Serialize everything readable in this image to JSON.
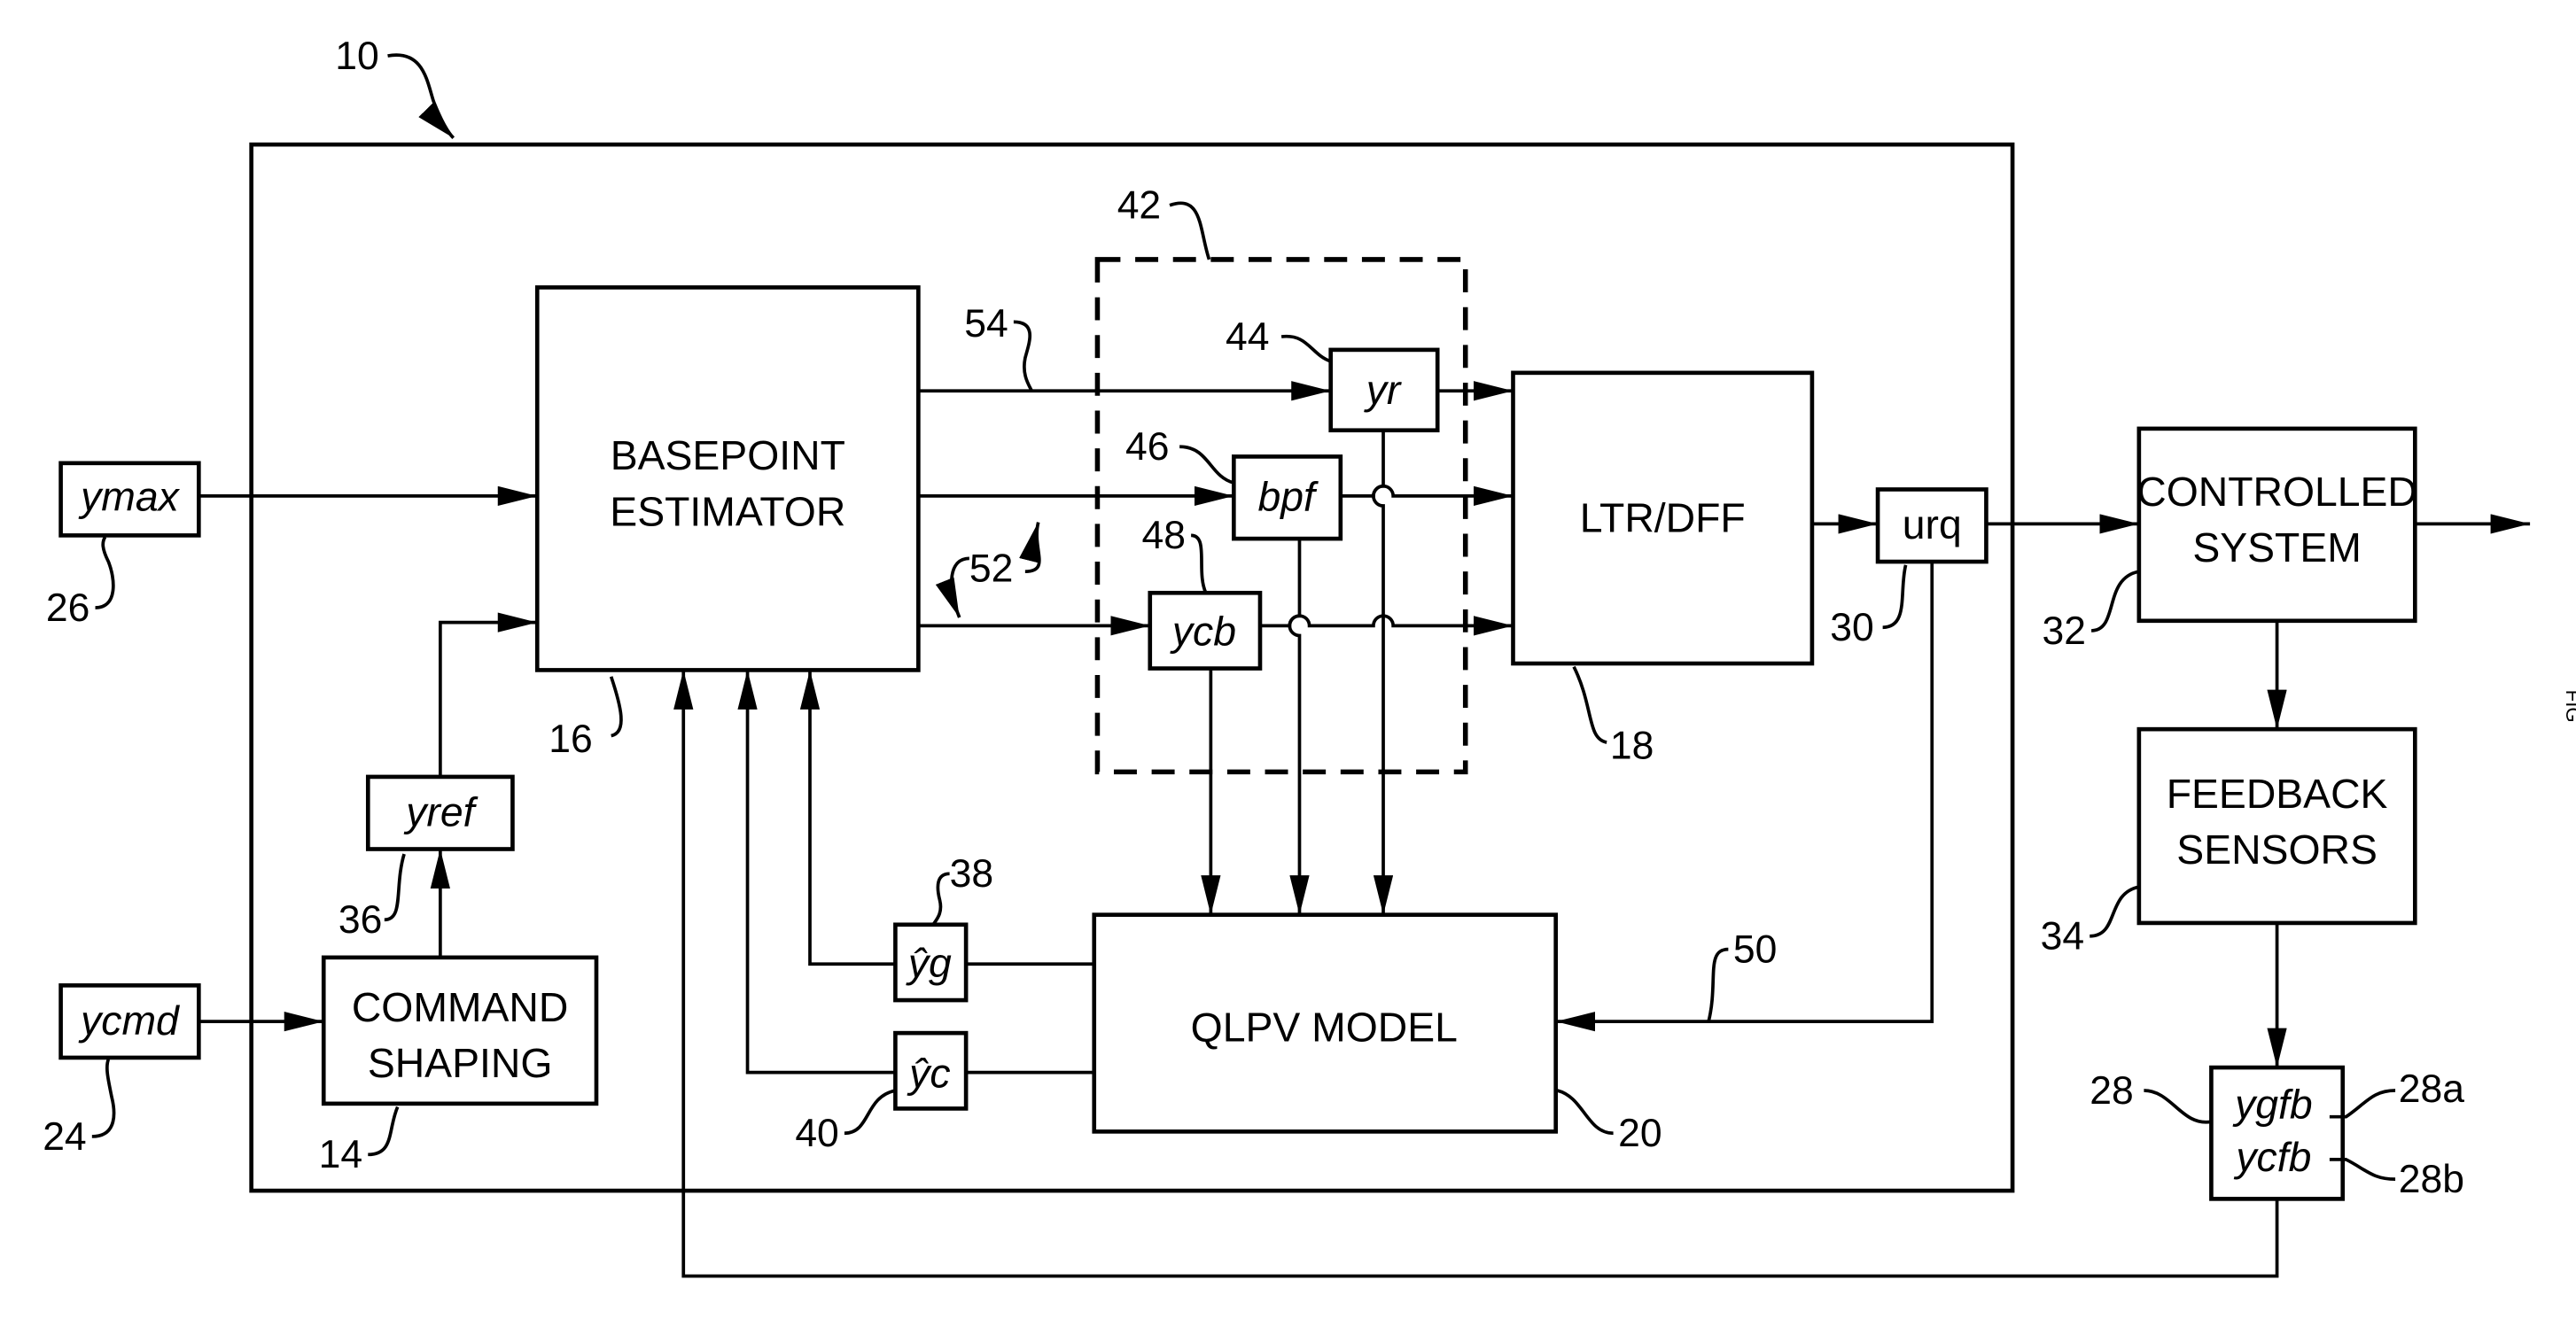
{
  "figure": {
    "system_ref": "10",
    "blocks": {
      "basepoint_estimator": {
        "line1": "BASEPOINT",
        "line2": "ESTIMATOR",
        "ref": "16"
      },
      "ltr_dff": {
        "label": "LTR/DFF",
        "ref": "18"
      },
      "qlpv_model": {
        "label": "QLPV MODEL",
        "ref": "20"
      },
      "command_shaping": {
        "line1": "COMMAND",
        "line2": "SHAPING",
        "ref": "14"
      },
      "controlled_system": {
        "line1": "CONTROLLED",
        "line2": "SYSTEM",
        "ref": "32"
      },
      "feedback_sensors": {
        "line1": "FEEDBACK",
        "line2": "SENSORS",
        "ref": "34"
      },
      "limiter_group": {
        "ref": "42"
      }
    },
    "signals": {
      "ymax": {
        "label": "ymax",
        "ref": "26"
      },
      "ycmd": {
        "label": "ycmd",
        "ref": "24"
      },
      "yref": {
        "label": "yref",
        "ref": "36"
      },
      "yr": {
        "label": "yr",
        "ref": "44"
      },
      "bpf": {
        "label": "bpf",
        "ref": "46"
      },
      "ycb": {
        "label": "ycb",
        "ref": "48"
      },
      "urq": {
        "label": "urq",
        "ref": "30"
      },
      "yg_hat": {
        "label": "ŷg",
        "ref": "38"
      },
      "yc_hat": {
        "label": "ŷc",
        "ref": "40"
      },
      "feedback": {
        "line1": "ygfb",
        "line2": "ycfb",
        "ref": "28",
        "ref_a": "28a",
        "ref_b": "28b"
      }
    },
    "path_refs": {
      "path_54": "54",
      "path_52": "52",
      "path_50": "50"
    },
    "edge_fragment": "FIG"
  }
}
